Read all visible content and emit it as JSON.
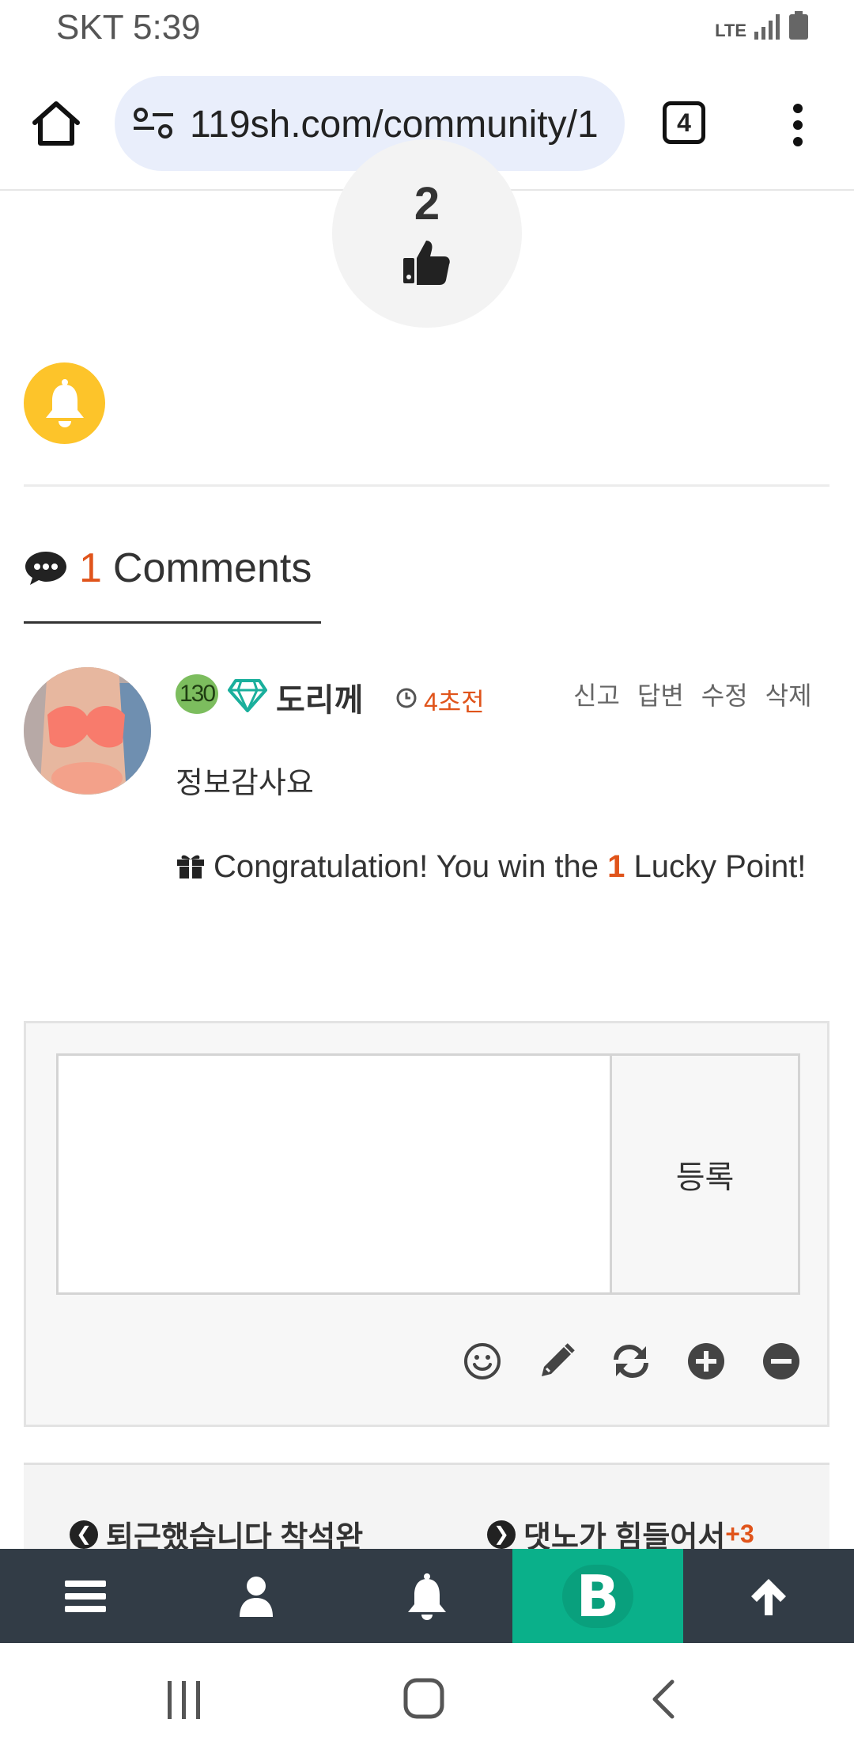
{
  "status_bar": {
    "carrier_time": "SKT 5:39",
    "network": "LTE"
  },
  "browser": {
    "url": "119sh.com/community/1",
    "tab_count": "4"
  },
  "post": {
    "like_count": "2"
  },
  "comments": {
    "count": "1",
    "label": "Comments",
    "items": [
      {
        "level": "130",
        "author": "도리께",
        "time": "4초전",
        "actions": [
          "신고",
          "답변",
          "수정",
          "삭제"
        ],
        "body": "정보감사요",
        "lucky_prefix": "Congratulation! You win the ",
        "lucky_points": "1",
        "lucky_suffix": " Lucky Point!"
      }
    ]
  },
  "comment_form": {
    "submit_label": "등록",
    "input_value": ""
  },
  "post_nav": {
    "prev_title": "퇴근했습니다 착석완",
    "next_title": "댓노가 힘들어서",
    "next_badge": "+3"
  },
  "bottom_bar": {
    "center_letter": "B"
  },
  "colors": {
    "accent": "#e0541b",
    "bell_bg": "#fdc42a",
    "app_bar": "#323c46",
    "brand_green": "#0ab08a",
    "url_bar": "#e9eefb"
  },
  "icons": [
    "home-icon",
    "site-info-icon",
    "more-menu-icon",
    "thumbs-up-icon",
    "bell-icon",
    "chat-bubble-icon",
    "diamond-icon",
    "clock-icon",
    "gift-icon",
    "smiley-icon",
    "pencil-icon",
    "refresh-icon",
    "plus-circle-icon",
    "minus-circle-icon",
    "hamburger-icon",
    "user-icon",
    "arrow-up-icon",
    "recents-icon",
    "home-circle-icon",
    "back-icon"
  ]
}
